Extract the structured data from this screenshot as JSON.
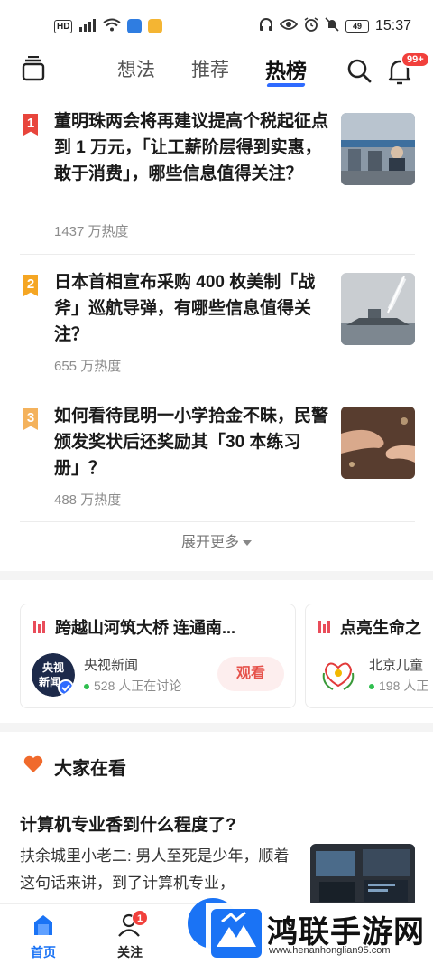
{
  "status_bar": {
    "network_label": "HD",
    "signal_label": "5G",
    "time": "15:37",
    "battery": "49"
  },
  "header": {
    "tabs": [
      {
        "label": "想法",
        "active": false
      },
      {
        "label": "推荐",
        "active": false
      },
      {
        "label": "热榜",
        "active": true
      }
    ],
    "notification_badge": "99+"
  },
  "hot_list": [
    {
      "rank": "1",
      "title": "董明珠两会将再建议提高个税起征点到 1 万元，「让工薪阶层得到实惠，敢于消费」，哪些信息值得关注？",
      "heat": "1437 万热度"
    },
    {
      "rank": "2",
      "title": "日本首相宣布采购 400 枚美制「战斧」巡航导弹，有哪些信息值得关注？",
      "heat": "655 万热度"
    },
    {
      "rank": "3",
      "title": "如何看待昆明一小学拾金不昧，民警颁发奖状后还奖励其「30 本练习册」？",
      "heat": "488 万热度"
    }
  ],
  "expand_more": "展开更多",
  "live_cards": [
    {
      "title": "跨越山河筑大桥 连通南...",
      "source": "央视新闻",
      "logo_text": "央视\n新闻",
      "viewers": "528 人正在讨论",
      "button": "观看"
    },
    {
      "title": "点亮生命之",
      "source": "北京儿童",
      "viewers": "198 人正"
    }
  ],
  "section": {
    "title": "大家在看"
  },
  "feed": {
    "title": "计算机专业香到什么程度了?",
    "text": "扶余城里小老二: 男人至死是少年，顺着这句话来讲，到了计算机专业，"
  },
  "bottom_nav": [
    {
      "label": "首页",
      "active": true
    },
    {
      "label": "关注",
      "badge": "1"
    }
  ],
  "watermark": {
    "name": "鸿联手游网",
    "url": "www.henanhonglian95.com"
  },
  "colors": {
    "accent": "#2f6bff",
    "rank1": "#e8453c",
    "rank2": "#f5a623",
    "rank3": "#f4b25c",
    "badge": "#f1403c"
  }
}
